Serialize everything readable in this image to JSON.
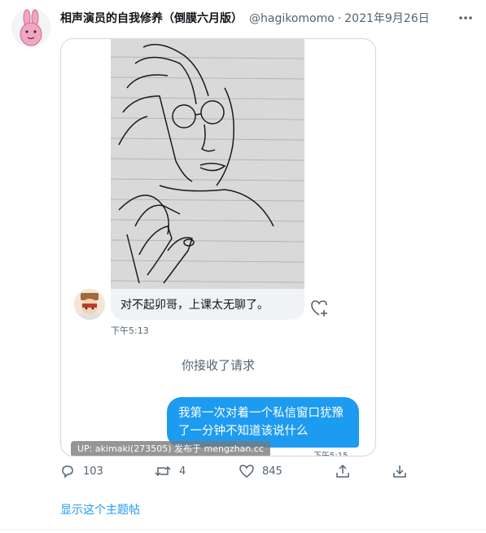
{
  "tweet": {
    "author_name": "相声演员的自我修养（倒膜六月版）",
    "author_handle": "@hagikomomo",
    "separator": "·",
    "date": "2021年9月26日",
    "more_icon": "more-horizontal-icon",
    "show_thread": "显示这个主题帖"
  },
  "dm": {
    "received_message": "对不起卯哥，上课太无聊了。",
    "received_time": "下午5:13",
    "accepted_notice": "你接收了请求",
    "sent_message_line1": "我第一次对着一个私信窗口犹豫",
    "sent_message_line2": "了一分钟不知道该说什么",
    "sent_time": "下午5:15",
    "bubble_color": "#1d9bf0"
  },
  "watermark": "UP: akimaki(273505) 发布于 mengzhan.cc",
  "actions": {
    "replies": "103",
    "retweets": "4",
    "likes": "845"
  },
  "colors": {
    "accent": "#1d9bf0",
    "secondary_text": "#536471"
  }
}
